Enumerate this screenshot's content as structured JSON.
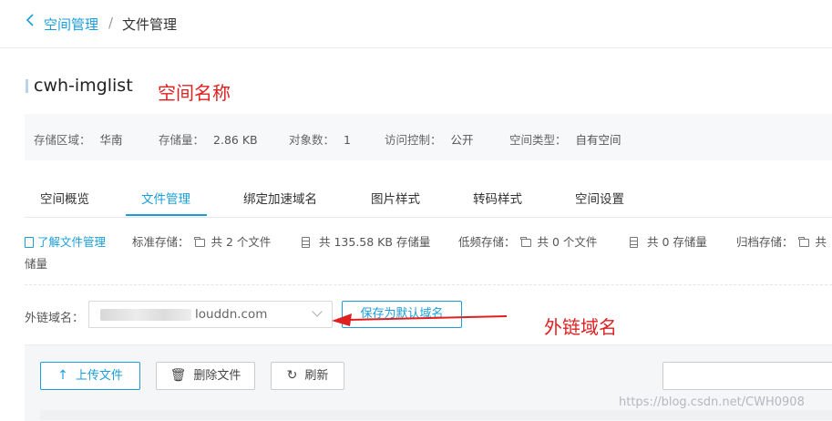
{
  "breadcrumb": {
    "back_icon": "chevron-left-icon",
    "parent": "空间管理",
    "separator": "/",
    "current": "文件管理"
  },
  "bucket": {
    "name": "cwh-imglist",
    "annotation": "空间名称"
  },
  "info": [
    {
      "label": "存储区域：",
      "value": "华南"
    },
    {
      "label": "存储量：",
      "value": "2.86 KB"
    },
    {
      "label": "对象数：",
      "value": "1"
    },
    {
      "label": "访问控制：",
      "value": "公开"
    },
    {
      "label": "空间类型：",
      "value": "自有空间"
    }
  ],
  "tabs": [
    {
      "label": "空间概览",
      "active": false
    },
    {
      "label": "文件管理",
      "active": true
    },
    {
      "label": "绑定加速域名",
      "active": false
    },
    {
      "label": "图片样式",
      "active": false
    },
    {
      "label": "转码样式",
      "active": false
    },
    {
      "label": "空间设置",
      "active": false
    }
  ],
  "stats": {
    "learn_link": "了解文件管理",
    "standard_label": "标准存储：",
    "standard_files": "共 2 个文件",
    "standard_size": "共 135.58 KB 存储量",
    "low_label": "低频存储：",
    "low_files": "共 0 个文件",
    "low_size": "共 0 存储量",
    "archive_label": "归档存储：",
    "archive_files_partial": "共",
    "wrap_text": "储量"
  },
  "domain": {
    "label": "外链域名：",
    "value_visible": "louddn.com",
    "save_button": "保存为默认域名",
    "annotation": "外链域名"
  },
  "toolbar": {
    "upload": "上传文件",
    "delete": "删除文件",
    "refresh": "刷新"
  },
  "watermark": "https://blog.csdn.net/CWH0908",
  "colors": {
    "accent": "#1a9ed9",
    "annotation": "#e02020"
  }
}
